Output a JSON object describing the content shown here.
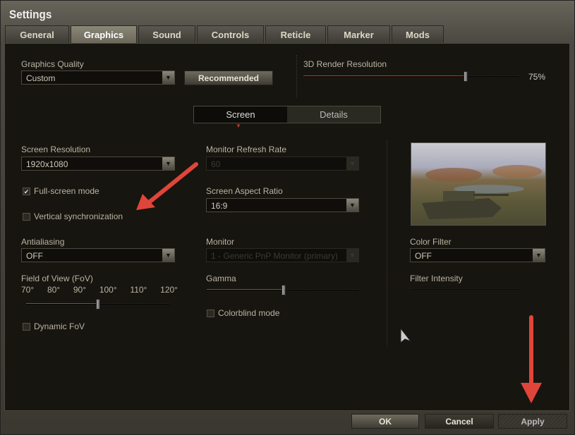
{
  "window": {
    "title": "Settings"
  },
  "tabs": [
    {
      "label": "General",
      "active": false
    },
    {
      "label": "Graphics",
      "active": true
    },
    {
      "label": "Sound",
      "active": false
    },
    {
      "label": "Controls",
      "active": false
    },
    {
      "label": "Reticle",
      "active": false
    },
    {
      "label": "Marker",
      "active": false
    },
    {
      "label": "Mods",
      "active": false
    }
  ],
  "graphics_quality": {
    "label": "Graphics Quality",
    "value": "Custom",
    "recommended": "Recommended"
  },
  "render_resolution": {
    "label": "3D Render Resolution",
    "value_text": "75%",
    "value_percent": 75
  },
  "subtabs": [
    {
      "label": "Screen",
      "active": true
    },
    {
      "label": "Details",
      "active": false
    }
  ],
  "screen_resolution": {
    "label": "Screen Resolution",
    "value": "1920x1080"
  },
  "fullscreen": {
    "label": "Full-screen mode",
    "checked": true
  },
  "vsync": {
    "label": "Vertical synchronization",
    "checked": false
  },
  "antialiasing": {
    "label": "Antialiasing",
    "value": "OFF"
  },
  "fov": {
    "label": "Field of View (FoV)",
    "ticks": [
      "70°",
      "80°",
      "90°",
      "100°",
      "110°",
      "120°"
    ],
    "value": 95
  },
  "dynamic_fov": {
    "label": "Dynamic FoV",
    "checked": false
  },
  "refresh_rate": {
    "label": "Monitor Refresh Rate",
    "value": "60",
    "disabled": true
  },
  "aspect_ratio": {
    "label": "Screen Aspect Ratio",
    "value": "16:9"
  },
  "monitor": {
    "label": "Monitor",
    "value": "1 - Generic PnP Monitor (primary)",
    "disabled": true
  },
  "gamma": {
    "label": "Gamma",
    "value_percent": 50
  },
  "colorblind": {
    "label": "Colorblind mode",
    "checked": false
  },
  "color_filter": {
    "label": "Color Filter",
    "value": "OFF"
  },
  "filter_intensity": {
    "label": "Filter Intensity"
  },
  "footer": {
    "ok": "OK",
    "cancel": "Cancel",
    "apply": "Apply"
  },
  "colors": {
    "accent_red": "#e0453a",
    "panel": "#17150f"
  }
}
